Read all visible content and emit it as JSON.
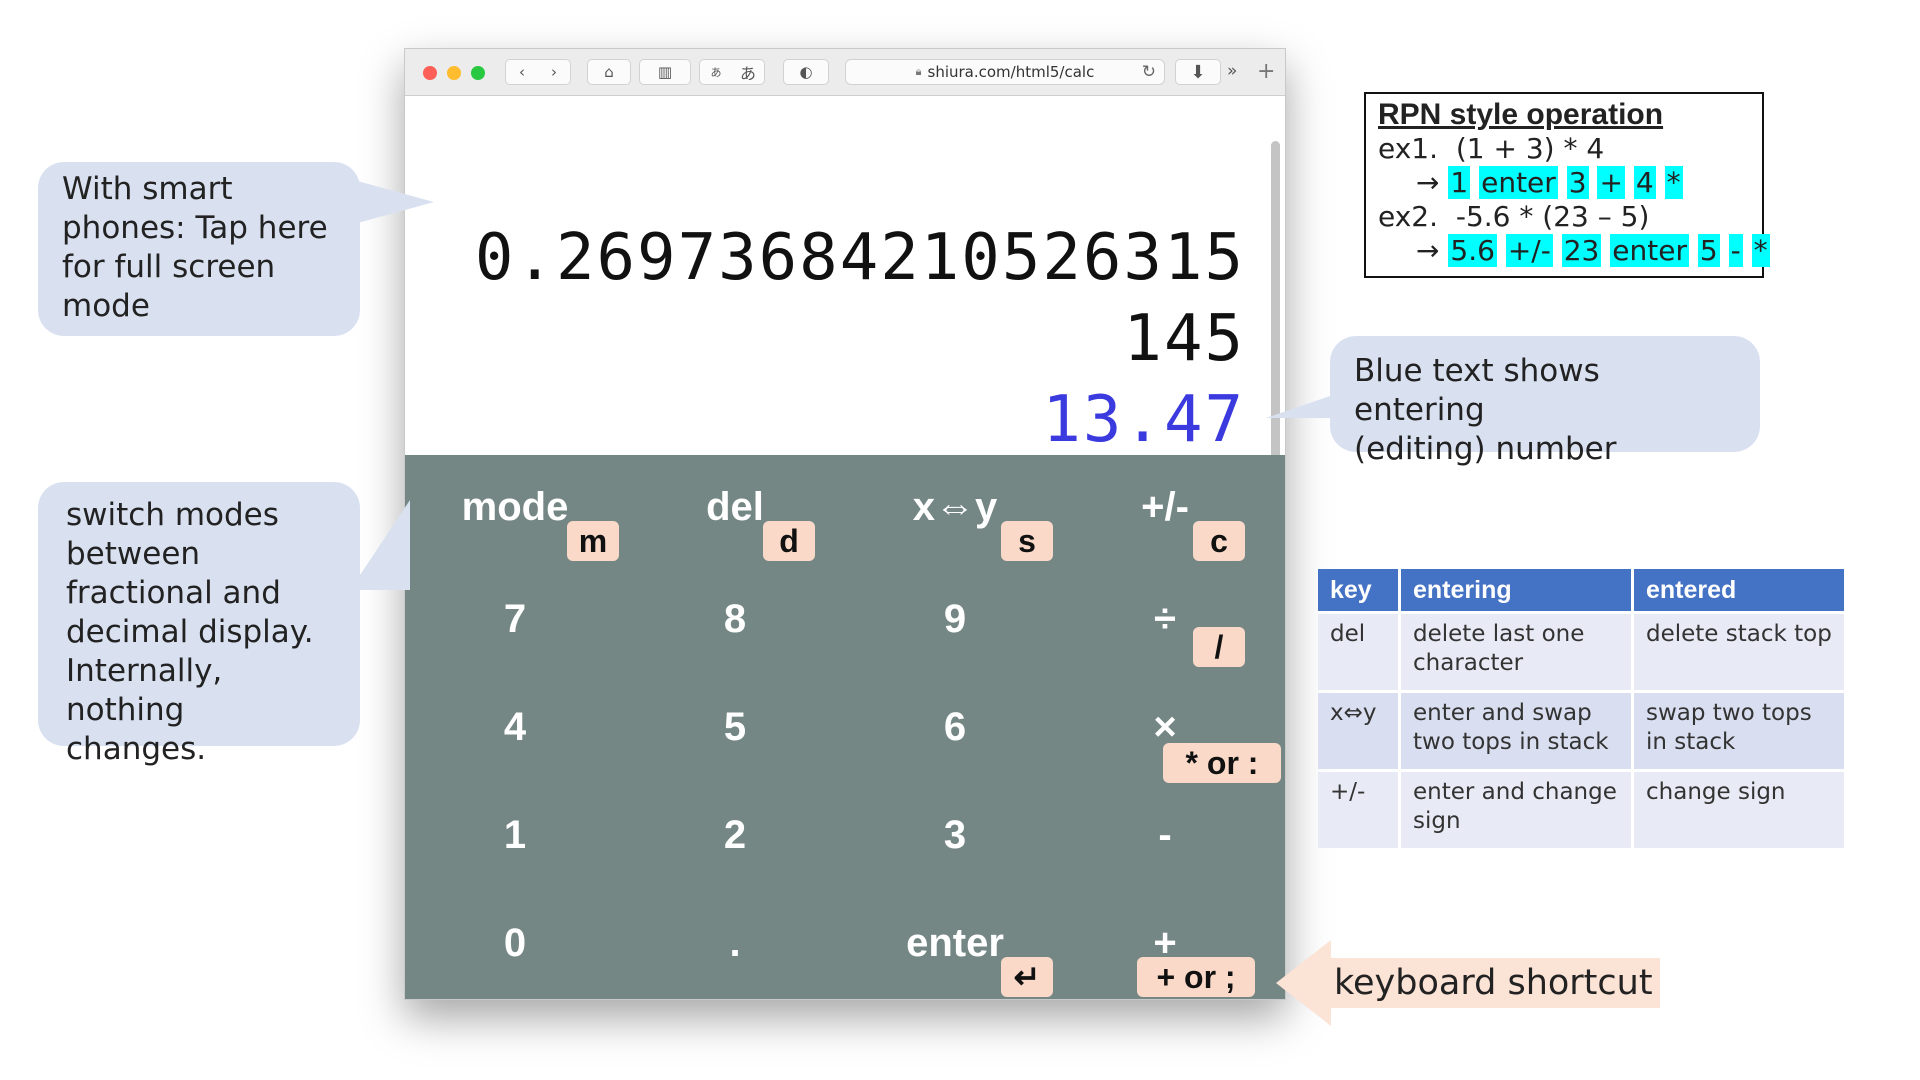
{
  "browser": {
    "url": "shiura.com/html5/calc",
    "icons": {
      "back": "chevron-left-icon",
      "forward": "chevron-right-icon",
      "home": "home-icon",
      "sidebar": "sidebar-icon",
      "reload": "reload-icon",
      "download": "download-icon",
      "more": "double-chevron-icon",
      "new_tab": "plus-icon"
    },
    "font_small": "あ",
    "font_large": "あ"
  },
  "display": {
    "stack": [
      "0.26973684210526315",
      "145"
    ],
    "entering": "13.47",
    "entering_color": "#3a3adf"
  },
  "keypad": {
    "bg_color": "#758785",
    "shortcut_color": "#fad9c9",
    "keys": {
      "mode": "mode",
      "del": "del",
      "swap": "x⇔y",
      "sign": "+/-",
      "k7": "7",
      "k8": "8",
      "k9": "9",
      "div": "÷",
      "k4": "4",
      "k5": "5",
      "k6": "6",
      "mul": "×",
      "k1": "1",
      "k2": "2",
      "k3": "3",
      "sub": "-",
      "k0": "0",
      "dot": ".",
      "enter": "enter",
      "add": "+"
    },
    "shortcuts": {
      "mode": "m",
      "del": "d",
      "swap": "s",
      "sign": "c",
      "div": "/",
      "mul": "* or :",
      "enter": "↵",
      "add": "+ or ;"
    }
  },
  "callouts": {
    "fullscreen": "With smart\nphones: Tap here\nfor full screen\nmode",
    "modes": "switch modes\nbetween\nfractional and\ndecimal display.\nInternally,\nnothing changes.",
    "blue_text": "Blue text shows entering\n(editing) number",
    "keyboard": "keyboard shortcut"
  },
  "rpn": {
    "title": "RPN style operation",
    "ex1_label": "ex1.",
    "ex1_expr": "(1 + 3) * 4",
    "ex1_steps": [
      "1",
      "enter",
      "3",
      "+",
      "4",
      "*"
    ],
    "ex2_label": "ex2.",
    "ex2_expr": "-5.6 * (23 – 5)",
    "ex2_steps": [
      "5.6",
      "+/-",
      "23",
      "enter",
      "5",
      "-",
      "*"
    ],
    "arrow": "→",
    "highlight_color": "#00ffff"
  },
  "help_table": {
    "headers": [
      "key",
      "entering",
      "entered"
    ],
    "rows": [
      [
        "del",
        "delete last one\ncharacter",
        "delete stack top"
      ],
      [
        "x⇔y",
        "enter and swap\ntwo tops in stack",
        "swap two tops\nin stack"
      ],
      [
        "+/-",
        "enter and change\nsign",
        "change sign"
      ]
    ]
  }
}
